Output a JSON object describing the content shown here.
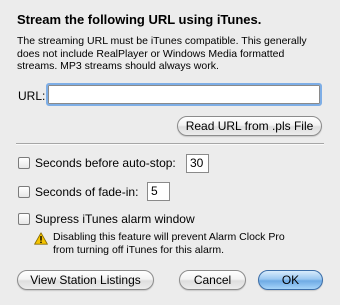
{
  "dialog": {
    "title": "Stream the following URL using iTunes.",
    "description": "The streaming URL must be iTunes compatible. This generally does not include RealPlayer or Windows Media formatted streams. MP3 streams should always work.",
    "url_label": "URL:",
    "url_value": "",
    "read_pls_button": "Read URL from .pls File"
  },
  "options": {
    "auto_stop": {
      "label": "Seconds before auto-stop:",
      "checked": false,
      "value": "30"
    },
    "fade_in": {
      "label": "Seconds of fade-in:",
      "checked": false,
      "value": "5"
    },
    "suppress_alarm": {
      "label": "Supress iTunes alarm window",
      "checked": false
    },
    "warning_text": "Disabling this feature will prevent Alarm Clock Pro from turning off iTunes for this alarm.",
    "warning_icon": "warning-triangle-icon"
  },
  "buttons": {
    "view_listings": "View Station Listings",
    "cancel": "Cancel",
    "ok": "OK"
  },
  "colors": {
    "background": "#ececec",
    "focus_ring": "#7eaee6",
    "default_button": "#6fabe5",
    "warning_fill": "#f5c400"
  }
}
